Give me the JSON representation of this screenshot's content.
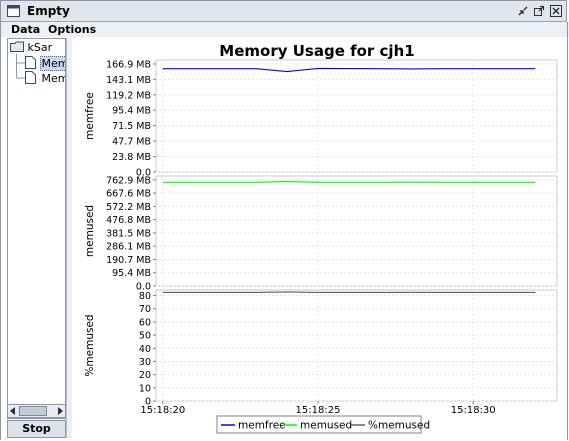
{
  "window": {
    "title": "Empty"
  },
  "menu": {
    "data": "Data",
    "options": "Options"
  },
  "tree": {
    "root": "kSar",
    "items": [
      {
        "label": "Memc",
        "selected": true
      },
      {
        "label": "Meme",
        "selected": false
      }
    ]
  },
  "stop_button": "Stop",
  "colors": {
    "memfree": "#0000ff",
    "memused": "#00ff00",
    "pctmemused": "#606060"
  },
  "chart_data": {
    "type": "line",
    "title": "Memory Usage for cjh1",
    "x_ticks": [
      "15:18:20",
      "15:18:25",
      "15:18:30"
    ],
    "x": [
      "15:18:20",
      "15:18:21",
      "15:18:22",
      "15:18:23",
      "15:18:24",
      "15:18:25",
      "15:18:26",
      "15:18:27",
      "15:18:28",
      "15:18:29",
      "15:18:30",
      "15:18:31",
      "15:18:32"
    ],
    "panels": [
      {
        "ylabel": "memfree",
        "yticks": [
          "166.9 MB",
          "143.1 MB",
          "119.2 MB",
          "95.4 MB",
          "71.5 MB",
          "47.7 MB",
          "23.8 MB",
          "0.0"
        ],
        "ylim": [
          0,
          166.9
        ],
        "series": {
          "name": "memfree",
          "values": [
            159.5,
            159.5,
            159.5,
            159.5,
            155.0,
            160.0,
            159.7,
            159.5,
            159.2,
            159.5,
            159.5,
            159.5,
            159.5
          ]
        }
      },
      {
        "ylabel": "memused",
        "yticks": [
          "762.9 MB",
          "667.6 MB",
          "572.2 MB",
          "476.8 MB",
          "381.5 MB",
          "286.1 MB",
          "190.7 MB",
          "95.4 MB",
          "0.0"
        ],
        "ylim": [
          0,
          762.9
        ],
        "series": {
          "name": "memused",
          "values": [
            745,
            745,
            745,
            745,
            750,
            745,
            745,
            745,
            746,
            745,
            745,
            745,
            745
          ]
        }
      },
      {
        "ylabel": "%memused",
        "yticks": [
          "80",
          "70",
          "60",
          "50",
          "40",
          "30",
          "20",
          "10",
          "0"
        ],
        "ylim": [
          0,
          88
        ],
        "series": {
          "name": "%memused",
          "values": [
            82.4,
            82.4,
            82.4,
            82.4,
            82.8,
            82.4,
            82.4,
            82.4,
            82.5,
            82.4,
            82.4,
            82.4,
            82.4
          ]
        }
      }
    ],
    "legend": [
      "memfree",
      "memused",
      "%memused"
    ],
    "legend_position": "bottom"
  }
}
